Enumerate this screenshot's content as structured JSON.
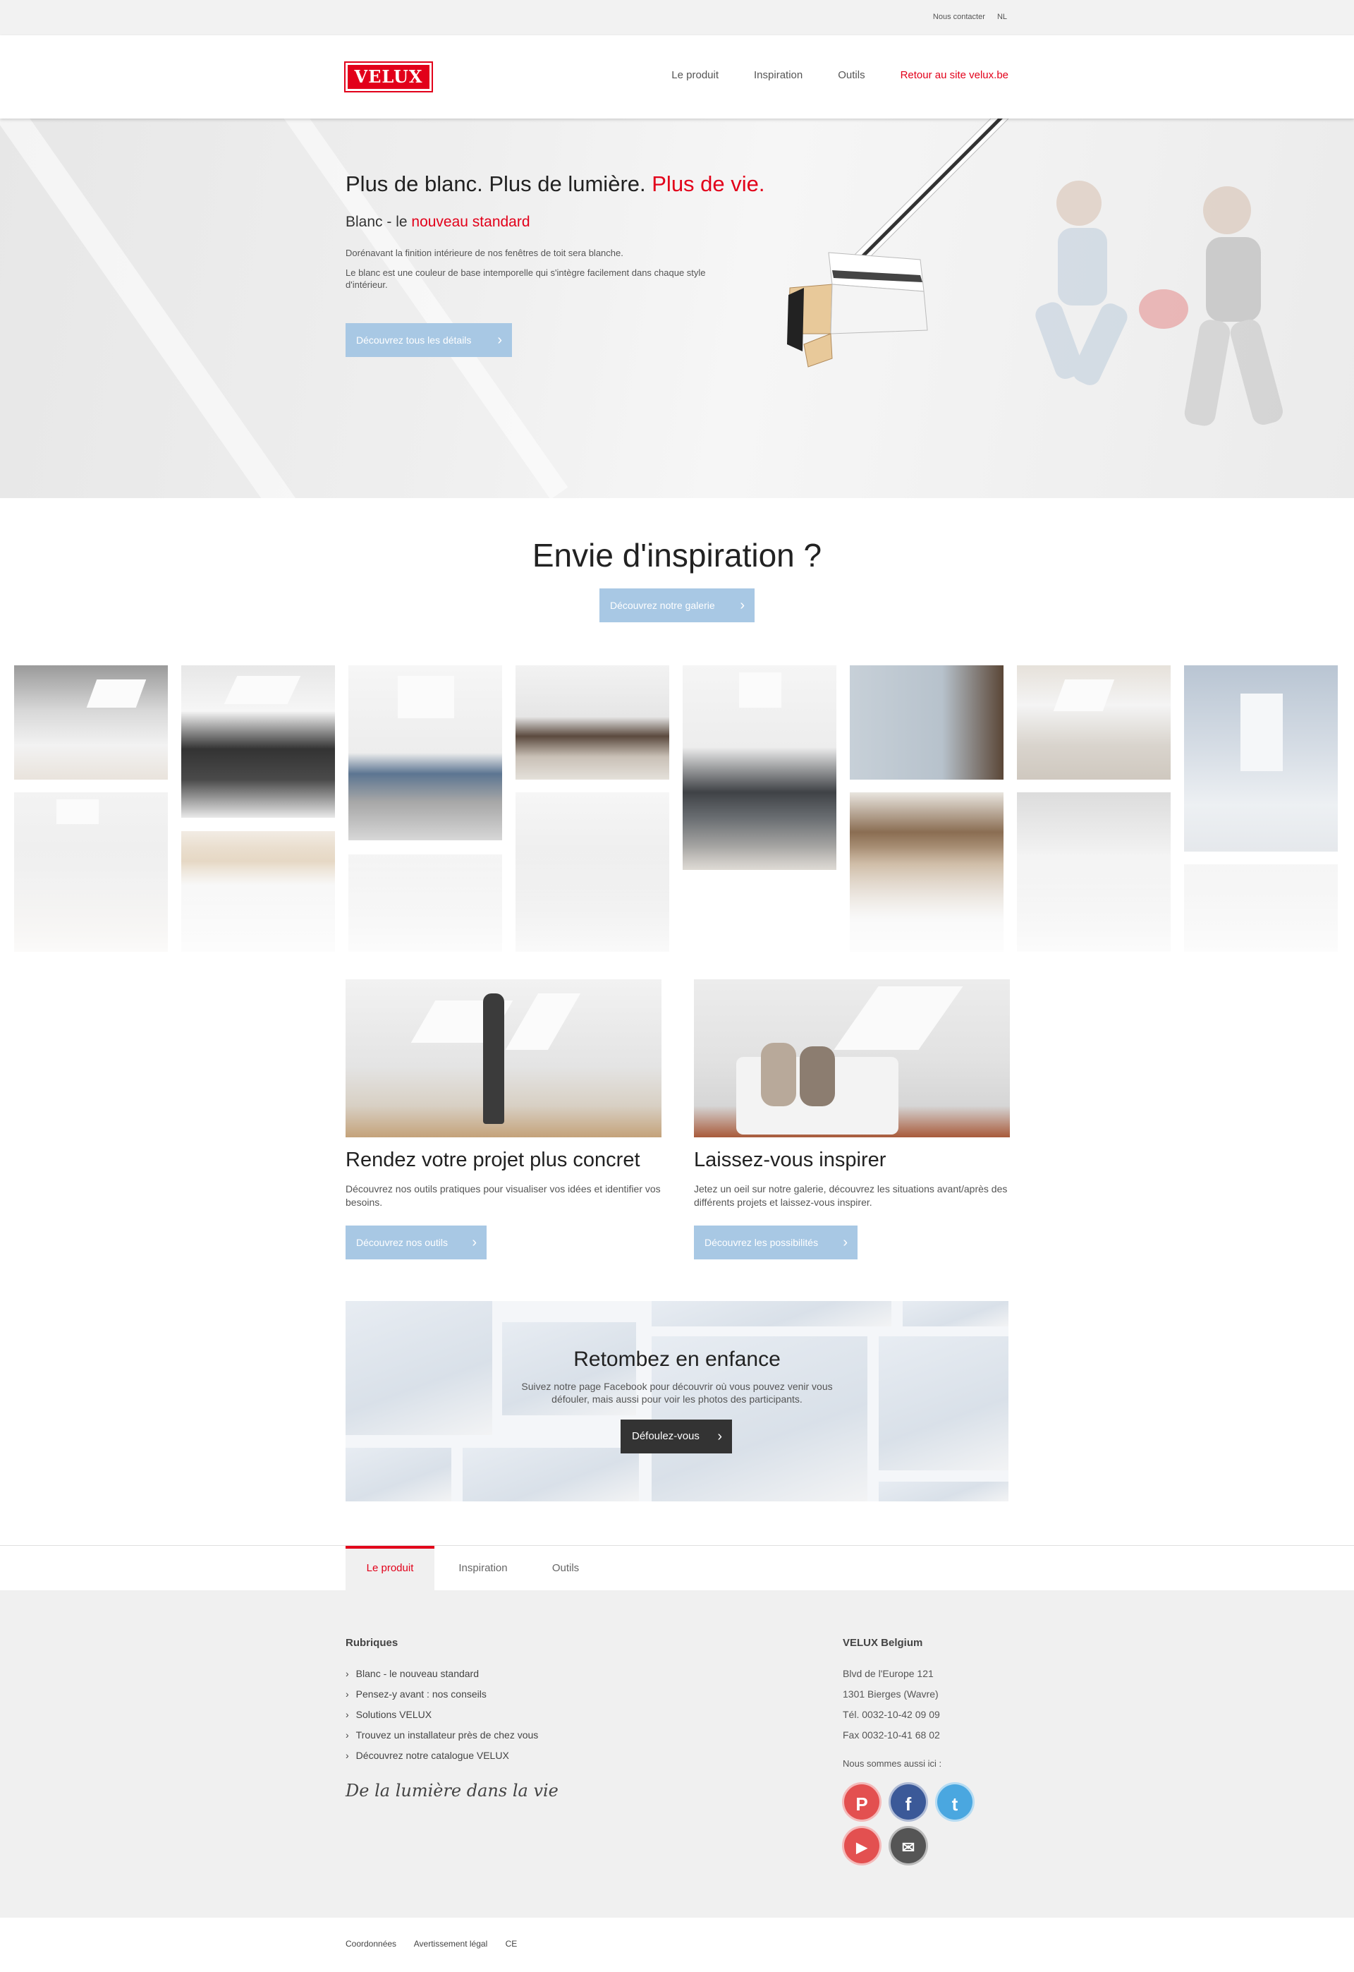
{
  "topbar": {
    "contact": "Nous contacter",
    "lang": "NL"
  },
  "header": {
    "logo": "VELUX",
    "nav": [
      "Le produit",
      "Inspiration",
      "Outils",
      "Retour au site velux.be"
    ]
  },
  "hero": {
    "title_part1": "Plus de blanc. Plus de lumière.",
    "title_part2": "Plus de vie.",
    "subtitle_part1": "Blanc - le",
    "subtitle_part2": "nouveau standard",
    "para1": "Dorénavant la finition intérieure de nos fenêtres de toit sera blanche.",
    "para2": "Le blanc est une couleur de base intemporelle qui s'intègre facilement dans chaque style d'intérieur.",
    "button": "Découvrez tous les détails"
  },
  "inspiration": {
    "title": "Envie d'inspiration ?",
    "button": "Découvrez notre galerie"
  },
  "cards": [
    {
      "title": "Rendez votre projet plus concret",
      "text": "Découvrez nos outils pratiques pour visualiser vos idées et identifier vos besoins.",
      "button": "Découvrez nos outils"
    },
    {
      "title": "Laissez-vous inspirer",
      "text": "Jetez un oeil sur notre galerie, découvrez les situations avant/après des différents projets et laissez-vous inspirer.",
      "button": "Découvrez les possibilités"
    }
  ],
  "facebook": {
    "title": "Retombez en enfance",
    "text": "Suivez notre page Facebook pour découvrir où vous pouvez venir vous défouler, mais aussi pour voir les photos des participants.",
    "button": "Défoulez-vous"
  },
  "tabs": [
    "Le produit",
    "Inspiration",
    "Outils"
  ],
  "footer": {
    "rubriques_title": "Rubriques",
    "rubriques": [
      "Blanc - le nouveau standard",
      "Pensez-y avant : nos conseils",
      "Solutions VELUX",
      "Trouvez un installateur près de chez vous",
      "Découvrez notre catalogue VELUX"
    ],
    "signature": "De la lumière dans la vie",
    "company": "VELUX Belgium",
    "address": [
      "Blvd de l'Europe 121",
      "1301 Bierges (Wavre)",
      "Tél. 0032-10-42 09 09",
      "Fax 0032-10-41 68 02"
    ],
    "social_title": "Nous sommes aussi ici :",
    "social": [
      {
        "icon": "pinterest-icon",
        "glyph": "P",
        "color": "#e35050"
      },
      {
        "icon": "facebook-icon",
        "glyph": "f",
        "color": "#3b5998"
      },
      {
        "icon": "twitter-icon",
        "glyph": "t",
        "color": "#4aa7e0"
      },
      {
        "icon": "youtube-icon",
        "glyph": "▶",
        "color": "#e35050"
      },
      {
        "icon": "mail-icon",
        "glyph": "✉",
        "color": "#555555"
      }
    ]
  },
  "legal": [
    "Coordonnées",
    "Avertissement légal",
    "CE"
  ],
  "colors": {
    "brand_red": "#e2001a",
    "button_blue": "#a8c8e4",
    "button_dark": "#333333"
  }
}
